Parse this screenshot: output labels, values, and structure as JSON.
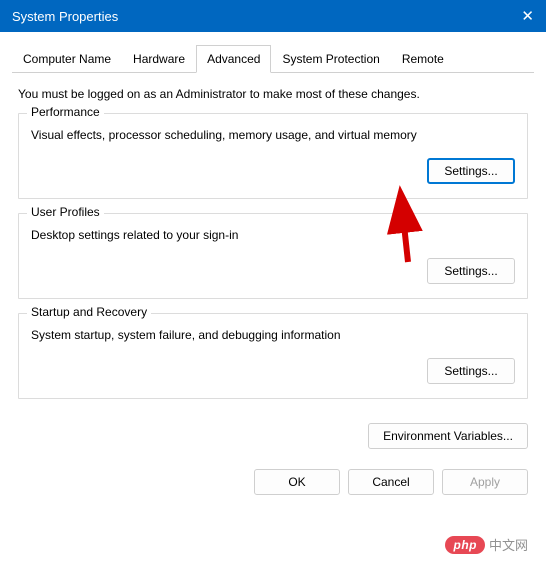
{
  "window": {
    "title": "System Properties",
    "close_label": "✕"
  },
  "tabs": {
    "computer_name": "Computer Name",
    "hardware": "Hardware",
    "advanced": "Advanced",
    "system_protection": "System Protection",
    "remote": "Remote"
  },
  "intro": "You must be logged on as an Administrator to make most of these changes.",
  "groups": {
    "performance": {
      "legend": "Performance",
      "desc": "Visual effects, processor scheduling, memory usage, and virtual memory",
      "button": "Settings..."
    },
    "user_profiles": {
      "legend": "User Profiles",
      "desc": "Desktop settings related to your sign-in",
      "button": "Settings..."
    },
    "startup": {
      "legend": "Startup and Recovery",
      "desc": "System startup, system failure, and debugging information",
      "button": "Settings..."
    }
  },
  "env_button": "Environment Variables...",
  "footer": {
    "ok": "OK",
    "cancel": "Cancel",
    "apply": "Apply"
  },
  "watermark": {
    "pill": "php",
    "cn": "中文网"
  }
}
